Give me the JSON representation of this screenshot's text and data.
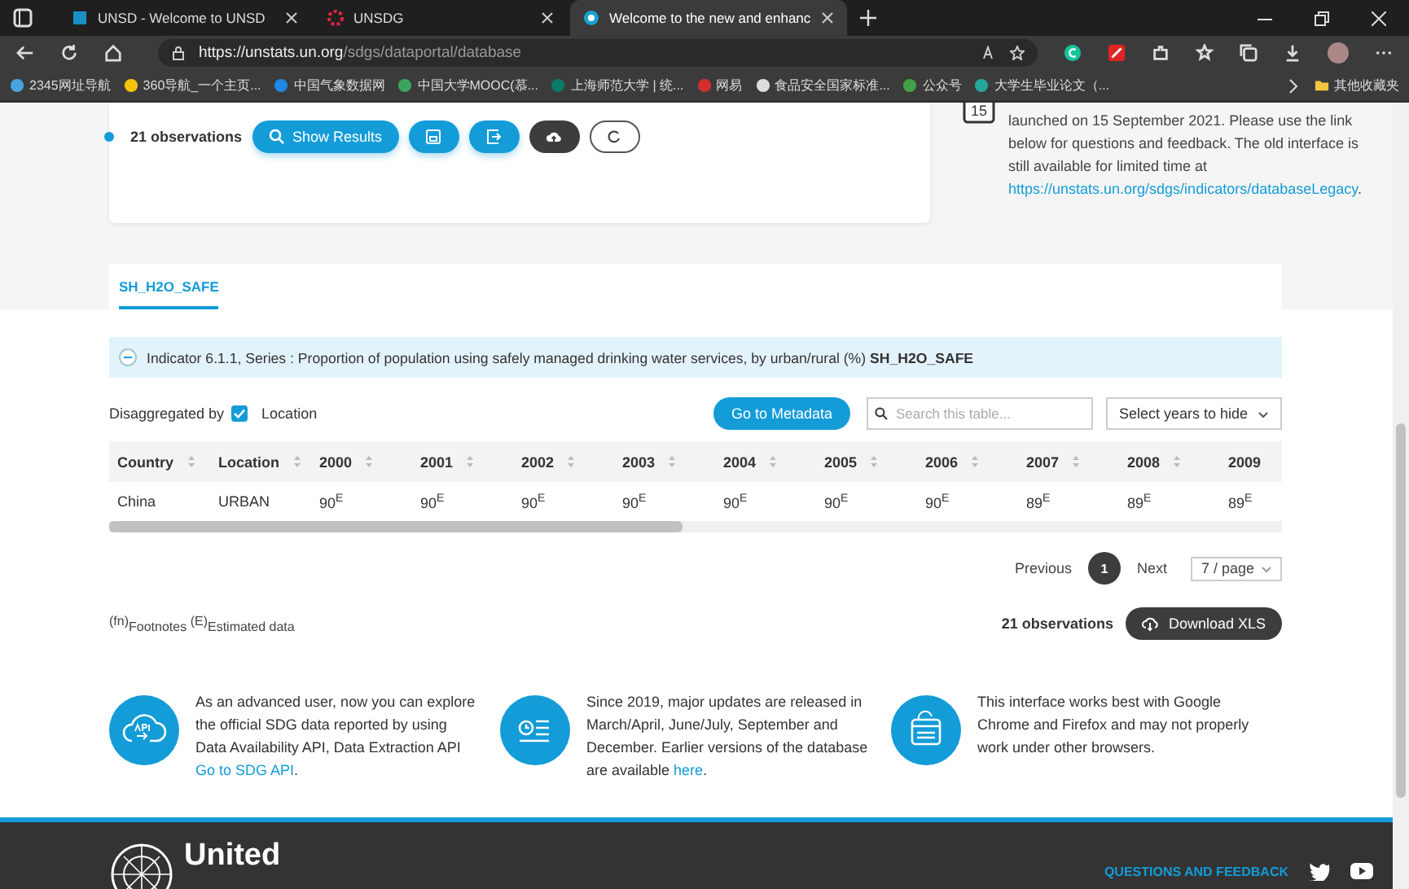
{
  "browser": {
    "tabs": [
      {
        "title": "UNSD - Welcome to UNSD",
        "selected": false
      },
      {
        "title": "UNSDG",
        "selected": false
      },
      {
        "title": "Welcome to the new and enhanc",
        "selected": true
      }
    ],
    "url_host": "https://unstats.un.org",
    "url_path": "/sdgs/dataportal/database",
    "bookmarks": [
      "2345网址导航",
      "360导航_一个主页...",
      "中国气象数据网",
      "中国大学MOOC(慕...",
      "上海师范大学 | 统...",
      "网易",
      "食品安全国家标准...",
      "公众号",
      "大学生毕业论文（..."
    ],
    "other_bookmarks": "其他收藏夹"
  },
  "query_card": {
    "observations": "21 observations",
    "show_results": "Show Results"
  },
  "notice": {
    "calendar_day": "15",
    "text": "launched on 15 September 2021. Please use the link below for questions and feedback. The old interface is still available for limited time at",
    "link": "https://unstats.un.org/sdgs/indicators/databaseLegacy",
    "end": "."
  },
  "series_tabs": [
    {
      "label": "SH_H2O_SAFE",
      "selected": true
    }
  ],
  "indicator": {
    "expanded": true,
    "text": "Indicator 6.1.1, Series : Proportion of population using safely managed drinking water services, by urban/rural (%) **SH_H2O_SAFE**"
  },
  "filters": {
    "disaggregated_label": "Disaggregated by",
    "location": {
      "label": "Location",
      "checked": true
    },
    "metadata_button": "Go to Metadata",
    "search": {
      "placeholder": "Search this table..."
    },
    "years_select": "Select years to hide"
  },
  "table": {
    "columns": [
      "Country",
      "Location",
      "2000",
      "2001",
      "2002",
      "2003",
      "2004",
      "2005",
      "2006",
      "2007",
      "2008",
      "2009"
    ],
    "rows": [
      [
        "China",
        "URBAN",
        "90$^{E}$",
        "90$^{E}$",
        "90$^{E}$",
        "90$^{E}$",
        "90$^{E}$",
        "90$^{E}$",
        "90$^{E}$",
        "89$^{E}$",
        "89$^{E}$",
        "89$^{E}$"
      ]
    ]
  },
  "pagination": {
    "previous": "Previous",
    "pages": [
      {
        "label": "1",
        "selected": true
      }
    ],
    "next": "Next",
    "page_size": "7 / page"
  },
  "legend": "$^{(fn)}$Footnotes $^{(E)}$Estimated data",
  "summary": {
    "observations": "21 observations",
    "download": "Download XLS"
  },
  "info_cards": [
    {
      "kind": "api",
      "text": "As an advanced user, now you can explore the official SDG data reported by using Data Availability API, Data Extraction API",
      "link": "Go to SDG API",
      "end": "."
    },
    {
      "kind": "updates",
      "text": "Since 2019, major updates are released in March/April, June/July, September and December. Earlier versions of the database are available",
      "link": "here",
      "end": "."
    },
    {
      "kind": "browser",
      "text": "This interface works best with Google Chrome and Firefox and may not properly work under other browsers."
    }
  ],
  "footer": {
    "logo_text": "United",
    "feedback_link": "QUESTIONS AND FEEDBACK"
  }
}
